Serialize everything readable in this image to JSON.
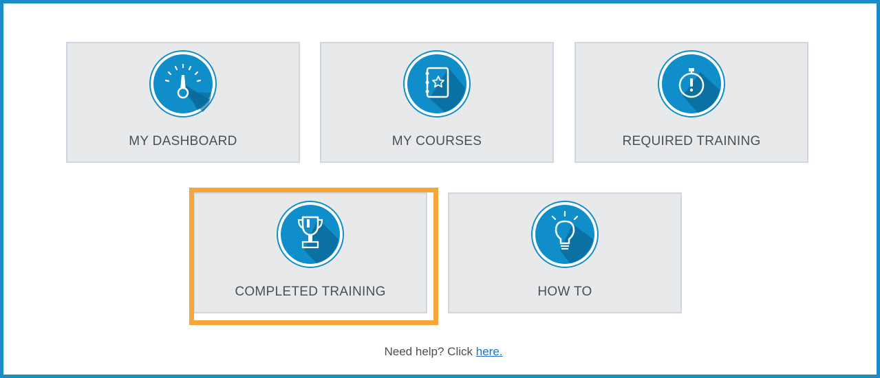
{
  "tiles": [
    {
      "label": "MY DASHBOARD",
      "icon": "gauge-icon"
    },
    {
      "label": "MY COURSES",
      "icon": "notebook-star-icon"
    },
    {
      "label": "REQUIRED TRAINING",
      "icon": "stopwatch-alert-icon"
    },
    {
      "label": "COMPLETED TRAINING",
      "icon": "trophy-icon",
      "highlighted": true
    },
    {
      "label": "HOW TO",
      "icon": "lightbulb-icon"
    }
  ],
  "help": {
    "prefix": "Need help? Click ",
    "link_text": "here."
  },
  "colors": {
    "frame_border": "#1a8bc4",
    "icon_blue": "#0f8ec9",
    "icon_shadow": "#0a6a9a",
    "tile_bg": "#e8e9ea",
    "highlight": "#f4a53b",
    "link": "#1a73c8"
  }
}
